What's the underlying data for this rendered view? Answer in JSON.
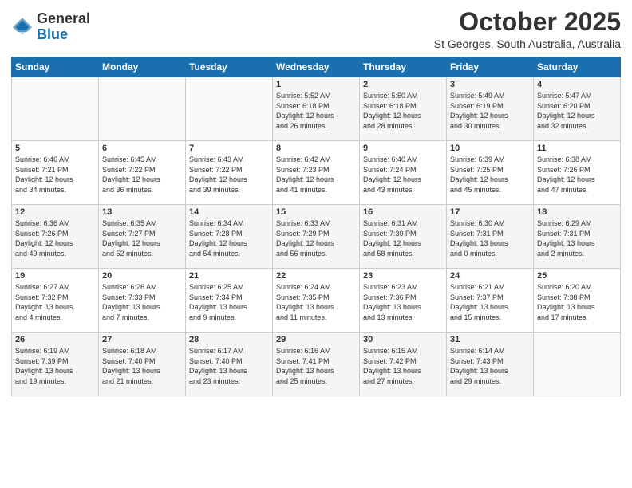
{
  "header": {
    "logo_general": "General",
    "logo_blue": "Blue",
    "month_title": "October 2025",
    "location": "St Georges, South Australia, Australia"
  },
  "days_of_week": [
    "Sunday",
    "Monday",
    "Tuesday",
    "Wednesday",
    "Thursday",
    "Friday",
    "Saturday"
  ],
  "weeks": [
    [
      {
        "day": "",
        "info": ""
      },
      {
        "day": "",
        "info": ""
      },
      {
        "day": "",
        "info": ""
      },
      {
        "day": "1",
        "info": "Sunrise: 5:52 AM\nSunset: 6:18 PM\nDaylight: 12 hours\nand 26 minutes."
      },
      {
        "day": "2",
        "info": "Sunrise: 5:50 AM\nSunset: 6:18 PM\nDaylight: 12 hours\nand 28 minutes."
      },
      {
        "day": "3",
        "info": "Sunrise: 5:49 AM\nSunset: 6:19 PM\nDaylight: 12 hours\nand 30 minutes."
      },
      {
        "day": "4",
        "info": "Sunrise: 5:47 AM\nSunset: 6:20 PM\nDaylight: 12 hours\nand 32 minutes."
      }
    ],
    [
      {
        "day": "5",
        "info": "Sunrise: 6:46 AM\nSunset: 7:21 PM\nDaylight: 12 hours\nand 34 minutes."
      },
      {
        "day": "6",
        "info": "Sunrise: 6:45 AM\nSunset: 7:22 PM\nDaylight: 12 hours\nand 36 minutes."
      },
      {
        "day": "7",
        "info": "Sunrise: 6:43 AM\nSunset: 7:22 PM\nDaylight: 12 hours\nand 39 minutes."
      },
      {
        "day": "8",
        "info": "Sunrise: 6:42 AM\nSunset: 7:23 PM\nDaylight: 12 hours\nand 41 minutes."
      },
      {
        "day": "9",
        "info": "Sunrise: 6:40 AM\nSunset: 7:24 PM\nDaylight: 12 hours\nand 43 minutes."
      },
      {
        "day": "10",
        "info": "Sunrise: 6:39 AM\nSunset: 7:25 PM\nDaylight: 12 hours\nand 45 minutes."
      },
      {
        "day": "11",
        "info": "Sunrise: 6:38 AM\nSunset: 7:26 PM\nDaylight: 12 hours\nand 47 minutes."
      }
    ],
    [
      {
        "day": "12",
        "info": "Sunrise: 6:36 AM\nSunset: 7:26 PM\nDaylight: 12 hours\nand 49 minutes."
      },
      {
        "day": "13",
        "info": "Sunrise: 6:35 AM\nSunset: 7:27 PM\nDaylight: 12 hours\nand 52 minutes."
      },
      {
        "day": "14",
        "info": "Sunrise: 6:34 AM\nSunset: 7:28 PM\nDaylight: 12 hours\nand 54 minutes."
      },
      {
        "day": "15",
        "info": "Sunrise: 6:33 AM\nSunset: 7:29 PM\nDaylight: 12 hours\nand 56 minutes."
      },
      {
        "day": "16",
        "info": "Sunrise: 6:31 AM\nSunset: 7:30 PM\nDaylight: 12 hours\nand 58 minutes."
      },
      {
        "day": "17",
        "info": "Sunrise: 6:30 AM\nSunset: 7:31 PM\nDaylight: 13 hours\nand 0 minutes."
      },
      {
        "day": "18",
        "info": "Sunrise: 6:29 AM\nSunset: 7:31 PM\nDaylight: 13 hours\nand 2 minutes."
      }
    ],
    [
      {
        "day": "19",
        "info": "Sunrise: 6:27 AM\nSunset: 7:32 PM\nDaylight: 13 hours\nand 4 minutes."
      },
      {
        "day": "20",
        "info": "Sunrise: 6:26 AM\nSunset: 7:33 PM\nDaylight: 13 hours\nand 7 minutes."
      },
      {
        "day": "21",
        "info": "Sunrise: 6:25 AM\nSunset: 7:34 PM\nDaylight: 13 hours\nand 9 minutes."
      },
      {
        "day": "22",
        "info": "Sunrise: 6:24 AM\nSunset: 7:35 PM\nDaylight: 13 hours\nand 11 minutes."
      },
      {
        "day": "23",
        "info": "Sunrise: 6:23 AM\nSunset: 7:36 PM\nDaylight: 13 hours\nand 13 minutes."
      },
      {
        "day": "24",
        "info": "Sunrise: 6:21 AM\nSunset: 7:37 PM\nDaylight: 13 hours\nand 15 minutes."
      },
      {
        "day": "25",
        "info": "Sunrise: 6:20 AM\nSunset: 7:38 PM\nDaylight: 13 hours\nand 17 minutes."
      }
    ],
    [
      {
        "day": "26",
        "info": "Sunrise: 6:19 AM\nSunset: 7:39 PM\nDaylight: 13 hours\nand 19 minutes."
      },
      {
        "day": "27",
        "info": "Sunrise: 6:18 AM\nSunset: 7:40 PM\nDaylight: 13 hours\nand 21 minutes."
      },
      {
        "day": "28",
        "info": "Sunrise: 6:17 AM\nSunset: 7:40 PM\nDaylight: 13 hours\nand 23 minutes."
      },
      {
        "day": "29",
        "info": "Sunrise: 6:16 AM\nSunset: 7:41 PM\nDaylight: 13 hours\nand 25 minutes."
      },
      {
        "day": "30",
        "info": "Sunrise: 6:15 AM\nSunset: 7:42 PM\nDaylight: 13 hours\nand 27 minutes."
      },
      {
        "day": "31",
        "info": "Sunrise: 6:14 AM\nSunset: 7:43 PM\nDaylight: 13 hours\nand 29 minutes."
      },
      {
        "day": "",
        "info": ""
      }
    ]
  ]
}
